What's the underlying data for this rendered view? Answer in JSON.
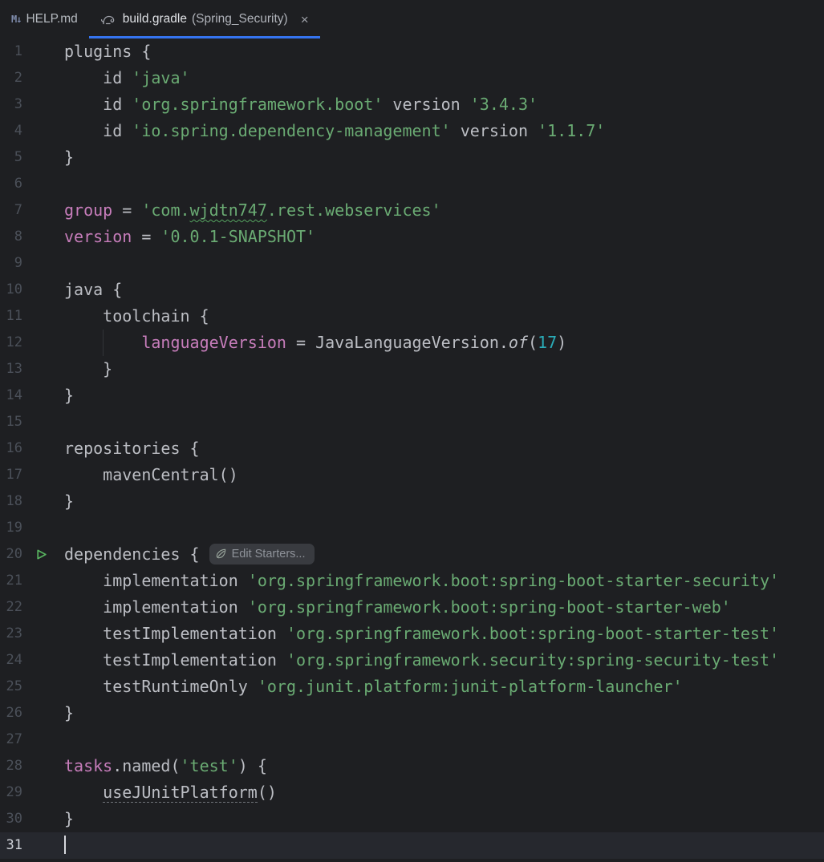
{
  "tab_bar": {
    "tabs": [
      {
        "icon": "markdown-icon",
        "icon_glyph": "M↓",
        "label": "HELP.md"
      },
      {
        "icon": "gradle-icon",
        "label": "build.gradle",
        "project": "(Spring_Security)",
        "close": "×"
      }
    ]
  },
  "colors": {
    "accent_blue": "#3574f0",
    "string_green": "#6aab73",
    "property_purple": "#c77dbb",
    "number_teal": "#2aacb8",
    "run_green": "#57b35f",
    "editor_bg": "#1e1f22",
    "current_line_bg": "#26282e"
  },
  "editor": {
    "inlay_label": "Edit Starters...",
    "caret_line": "31",
    "lines": [
      {
        "n": "1",
        "seg": [
          {
            "t": "p",
            "s": "plugins {"
          }
        ]
      },
      {
        "n": "2",
        "seg": [
          {
            "t": "p",
            "s": "    id "
          },
          {
            "t": "s",
            "s": "'java'"
          }
        ]
      },
      {
        "n": "3",
        "seg": [
          {
            "t": "p",
            "s": "    id "
          },
          {
            "t": "s",
            "s": "'org.springframework.boot'"
          },
          {
            "t": "p",
            "s": " version "
          },
          {
            "t": "s",
            "s": "'3.4.3'"
          }
        ]
      },
      {
        "n": "4",
        "seg": [
          {
            "t": "p",
            "s": "    id "
          },
          {
            "t": "s",
            "s": "'io.spring.dependency-management'"
          },
          {
            "t": "p",
            "s": " version "
          },
          {
            "t": "s",
            "s": "'1.1.7'"
          }
        ]
      },
      {
        "n": "5",
        "seg": [
          {
            "t": "p",
            "s": "}"
          }
        ]
      },
      {
        "n": "6",
        "seg": []
      },
      {
        "n": "7",
        "seg": [
          {
            "t": "k",
            "s": "group"
          },
          {
            "t": "p",
            "s": " = "
          },
          {
            "t": "s",
            "s": "'com."
          },
          {
            "t": "typo",
            "s": "wjdtn747"
          },
          {
            "t": "s",
            "s": ".rest.webservices'"
          }
        ]
      },
      {
        "n": "8",
        "seg": [
          {
            "t": "k",
            "s": "version"
          },
          {
            "t": "p",
            "s": " = "
          },
          {
            "t": "s",
            "s": "'0.0.1-SNAPSHOT'"
          }
        ]
      },
      {
        "n": "9",
        "seg": []
      },
      {
        "n": "10",
        "seg": [
          {
            "t": "p",
            "s": "java {"
          }
        ]
      },
      {
        "n": "11",
        "seg": [
          {
            "t": "p",
            "s": "    toolchain {"
          }
        ]
      },
      {
        "n": "12",
        "guide": true,
        "seg": [
          {
            "t": "p",
            "s": "        "
          },
          {
            "t": "k",
            "s": "languageVersion"
          },
          {
            "t": "p",
            "s": " = JavaLanguageVersion."
          },
          {
            "t": "i",
            "s": "of"
          },
          {
            "t": "p",
            "s": "("
          },
          {
            "t": "num",
            "s": "17"
          },
          {
            "t": "p",
            "s": ")"
          }
        ]
      },
      {
        "n": "13",
        "seg": [
          {
            "t": "p",
            "s": "    }"
          }
        ]
      },
      {
        "n": "14",
        "seg": [
          {
            "t": "p",
            "s": "}"
          }
        ]
      },
      {
        "n": "15",
        "seg": []
      },
      {
        "n": "16",
        "seg": [
          {
            "t": "p",
            "s": "repositories {"
          }
        ]
      },
      {
        "n": "17",
        "seg": [
          {
            "t": "p",
            "s": "    mavenCentral()"
          }
        ]
      },
      {
        "n": "18",
        "seg": [
          {
            "t": "p",
            "s": "}"
          }
        ]
      },
      {
        "n": "19",
        "seg": []
      },
      {
        "n": "20",
        "icon": "run",
        "seg": [
          {
            "t": "p",
            "s": "dependencies { "
          },
          {
            "t": "inlay"
          }
        ]
      },
      {
        "n": "21",
        "seg": [
          {
            "t": "p",
            "s": "    implementation "
          },
          {
            "t": "s",
            "s": "'org.springframework.boot:spring-boot-starter-security'"
          }
        ]
      },
      {
        "n": "22",
        "seg": [
          {
            "t": "p",
            "s": "    implementation "
          },
          {
            "t": "s",
            "s": "'org.springframework.boot:spring-boot-starter-web'"
          }
        ]
      },
      {
        "n": "23",
        "seg": [
          {
            "t": "p",
            "s": "    testImplementation "
          },
          {
            "t": "s",
            "s": "'org.springframework.boot:spring-boot-starter-test'"
          }
        ]
      },
      {
        "n": "24",
        "seg": [
          {
            "t": "p",
            "s": "    testImplementation "
          },
          {
            "t": "s",
            "s": "'org.springframework.security:spring-security-test'"
          }
        ]
      },
      {
        "n": "25",
        "seg": [
          {
            "t": "p",
            "s": "    testRuntimeOnly "
          },
          {
            "t": "s",
            "s": "'org.junit.platform:junit-platform-launcher'"
          }
        ]
      },
      {
        "n": "26",
        "seg": [
          {
            "t": "p",
            "s": "}"
          }
        ]
      },
      {
        "n": "27",
        "seg": []
      },
      {
        "n": "28",
        "seg": [
          {
            "t": "k",
            "s": "tasks"
          },
          {
            "t": "p",
            "s": ".named("
          },
          {
            "t": "s",
            "s": "'test'"
          },
          {
            "t": "p",
            "s": ") {"
          }
        ]
      },
      {
        "n": "29",
        "seg": [
          {
            "t": "p",
            "s": "    "
          },
          {
            "t": "u",
            "s": "useJUnitPlatform"
          },
          {
            "t": "p",
            "s": "()"
          }
        ]
      },
      {
        "n": "30",
        "seg": [
          {
            "t": "p",
            "s": "}"
          }
        ]
      },
      {
        "n": "31",
        "current": true,
        "caret": true,
        "seg": []
      }
    ]
  }
}
